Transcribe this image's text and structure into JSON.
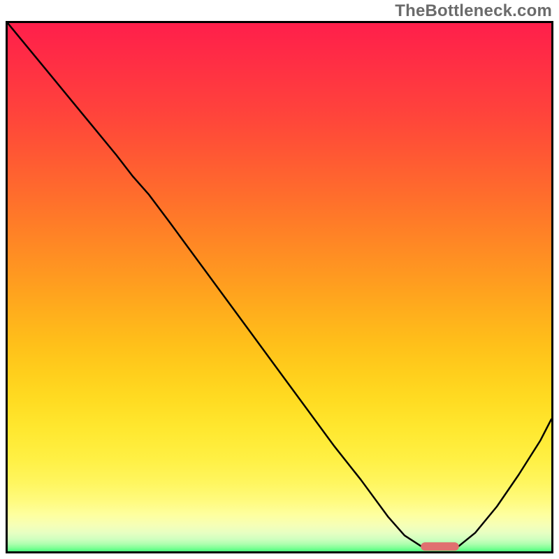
{
  "watermark": "TheBottleneck.com",
  "chart_data": {
    "type": "line",
    "title": "",
    "xlabel": "",
    "ylabel": "",
    "xlim": [
      0,
      100
    ],
    "ylim": [
      0,
      100
    ],
    "grid": false,
    "legend": false,
    "background_gradient": {
      "stops": [
        {
          "offset": 0.0,
          "color": "#ff1f4b"
        },
        {
          "offset": 0.055,
          "color": "#ff2a46"
        },
        {
          "offset": 0.11,
          "color": "#ff3641"
        },
        {
          "offset": 0.165,
          "color": "#ff423c"
        },
        {
          "offset": 0.22,
          "color": "#ff5036"
        },
        {
          "offset": 0.275,
          "color": "#ff5f31"
        },
        {
          "offset": 0.33,
          "color": "#ff6e2c"
        },
        {
          "offset": 0.385,
          "color": "#ff7e27"
        },
        {
          "offset": 0.44,
          "color": "#ff8e23"
        },
        {
          "offset": 0.495,
          "color": "#ff9e1f"
        },
        {
          "offset": 0.55,
          "color": "#ffaf1c"
        },
        {
          "offset": 0.605,
          "color": "#ffbf1a"
        },
        {
          "offset": 0.66,
          "color": "#ffce1c"
        },
        {
          "offset": 0.715,
          "color": "#ffdc22"
        },
        {
          "offset": 0.77,
          "color": "#ffe830"
        },
        {
          "offset": 0.825,
          "color": "#fff044"
        },
        {
          "offset": 0.87,
          "color": "#fff65f"
        },
        {
          "offset": 0.905,
          "color": "#fffb7f"
        },
        {
          "offset": 0.93,
          "color": "#feff9e"
        },
        {
          "offset": 0.95,
          "color": "#f6ffb6"
        },
        {
          "offset": 0.965,
          "color": "#e7ffc2"
        },
        {
          "offset": 0.977,
          "color": "#cfffbf"
        },
        {
          "offset": 0.986,
          "color": "#afffaf"
        },
        {
          "offset": 0.993,
          "color": "#85ff98"
        },
        {
          "offset": 1.0,
          "color": "#4cff7d"
        }
      ]
    },
    "series": [
      {
        "name": "curve",
        "color": "#000000",
        "width": 2.5,
        "x": [
          0.0,
          4.0,
          8.0,
          12.0,
          16.0,
          20.0,
          23.0,
          26.0,
          30.0,
          35.0,
          40.0,
          45.0,
          50.0,
          55.0,
          60.0,
          65.0,
          70.0,
          73.0,
          76.0,
          80.0,
          83.0,
          86.0,
          90.0,
          94.0,
          98.0,
          100.0
        ],
        "y": [
          100.0,
          95.0,
          90.0,
          85.0,
          80.0,
          75.0,
          71.0,
          67.5,
          62.0,
          55.0,
          48.0,
          41.0,
          34.0,
          27.0,
          20.0,
          13.5,
          6.5,
          3.0,
          1.0,
          0.6,
          1.0,
          3.5,
          8.5,
          14.5,
          21.0,
          25.0
        ]
      }
    ],
    "marker": {
      "shape": "rounded-bar",
      "color": "#e07070",
      "x_center": 79.5,
      "y_center": 0.9,
      "width_x": 7.0,
      "height_y": 1.6
    }
  }
}
